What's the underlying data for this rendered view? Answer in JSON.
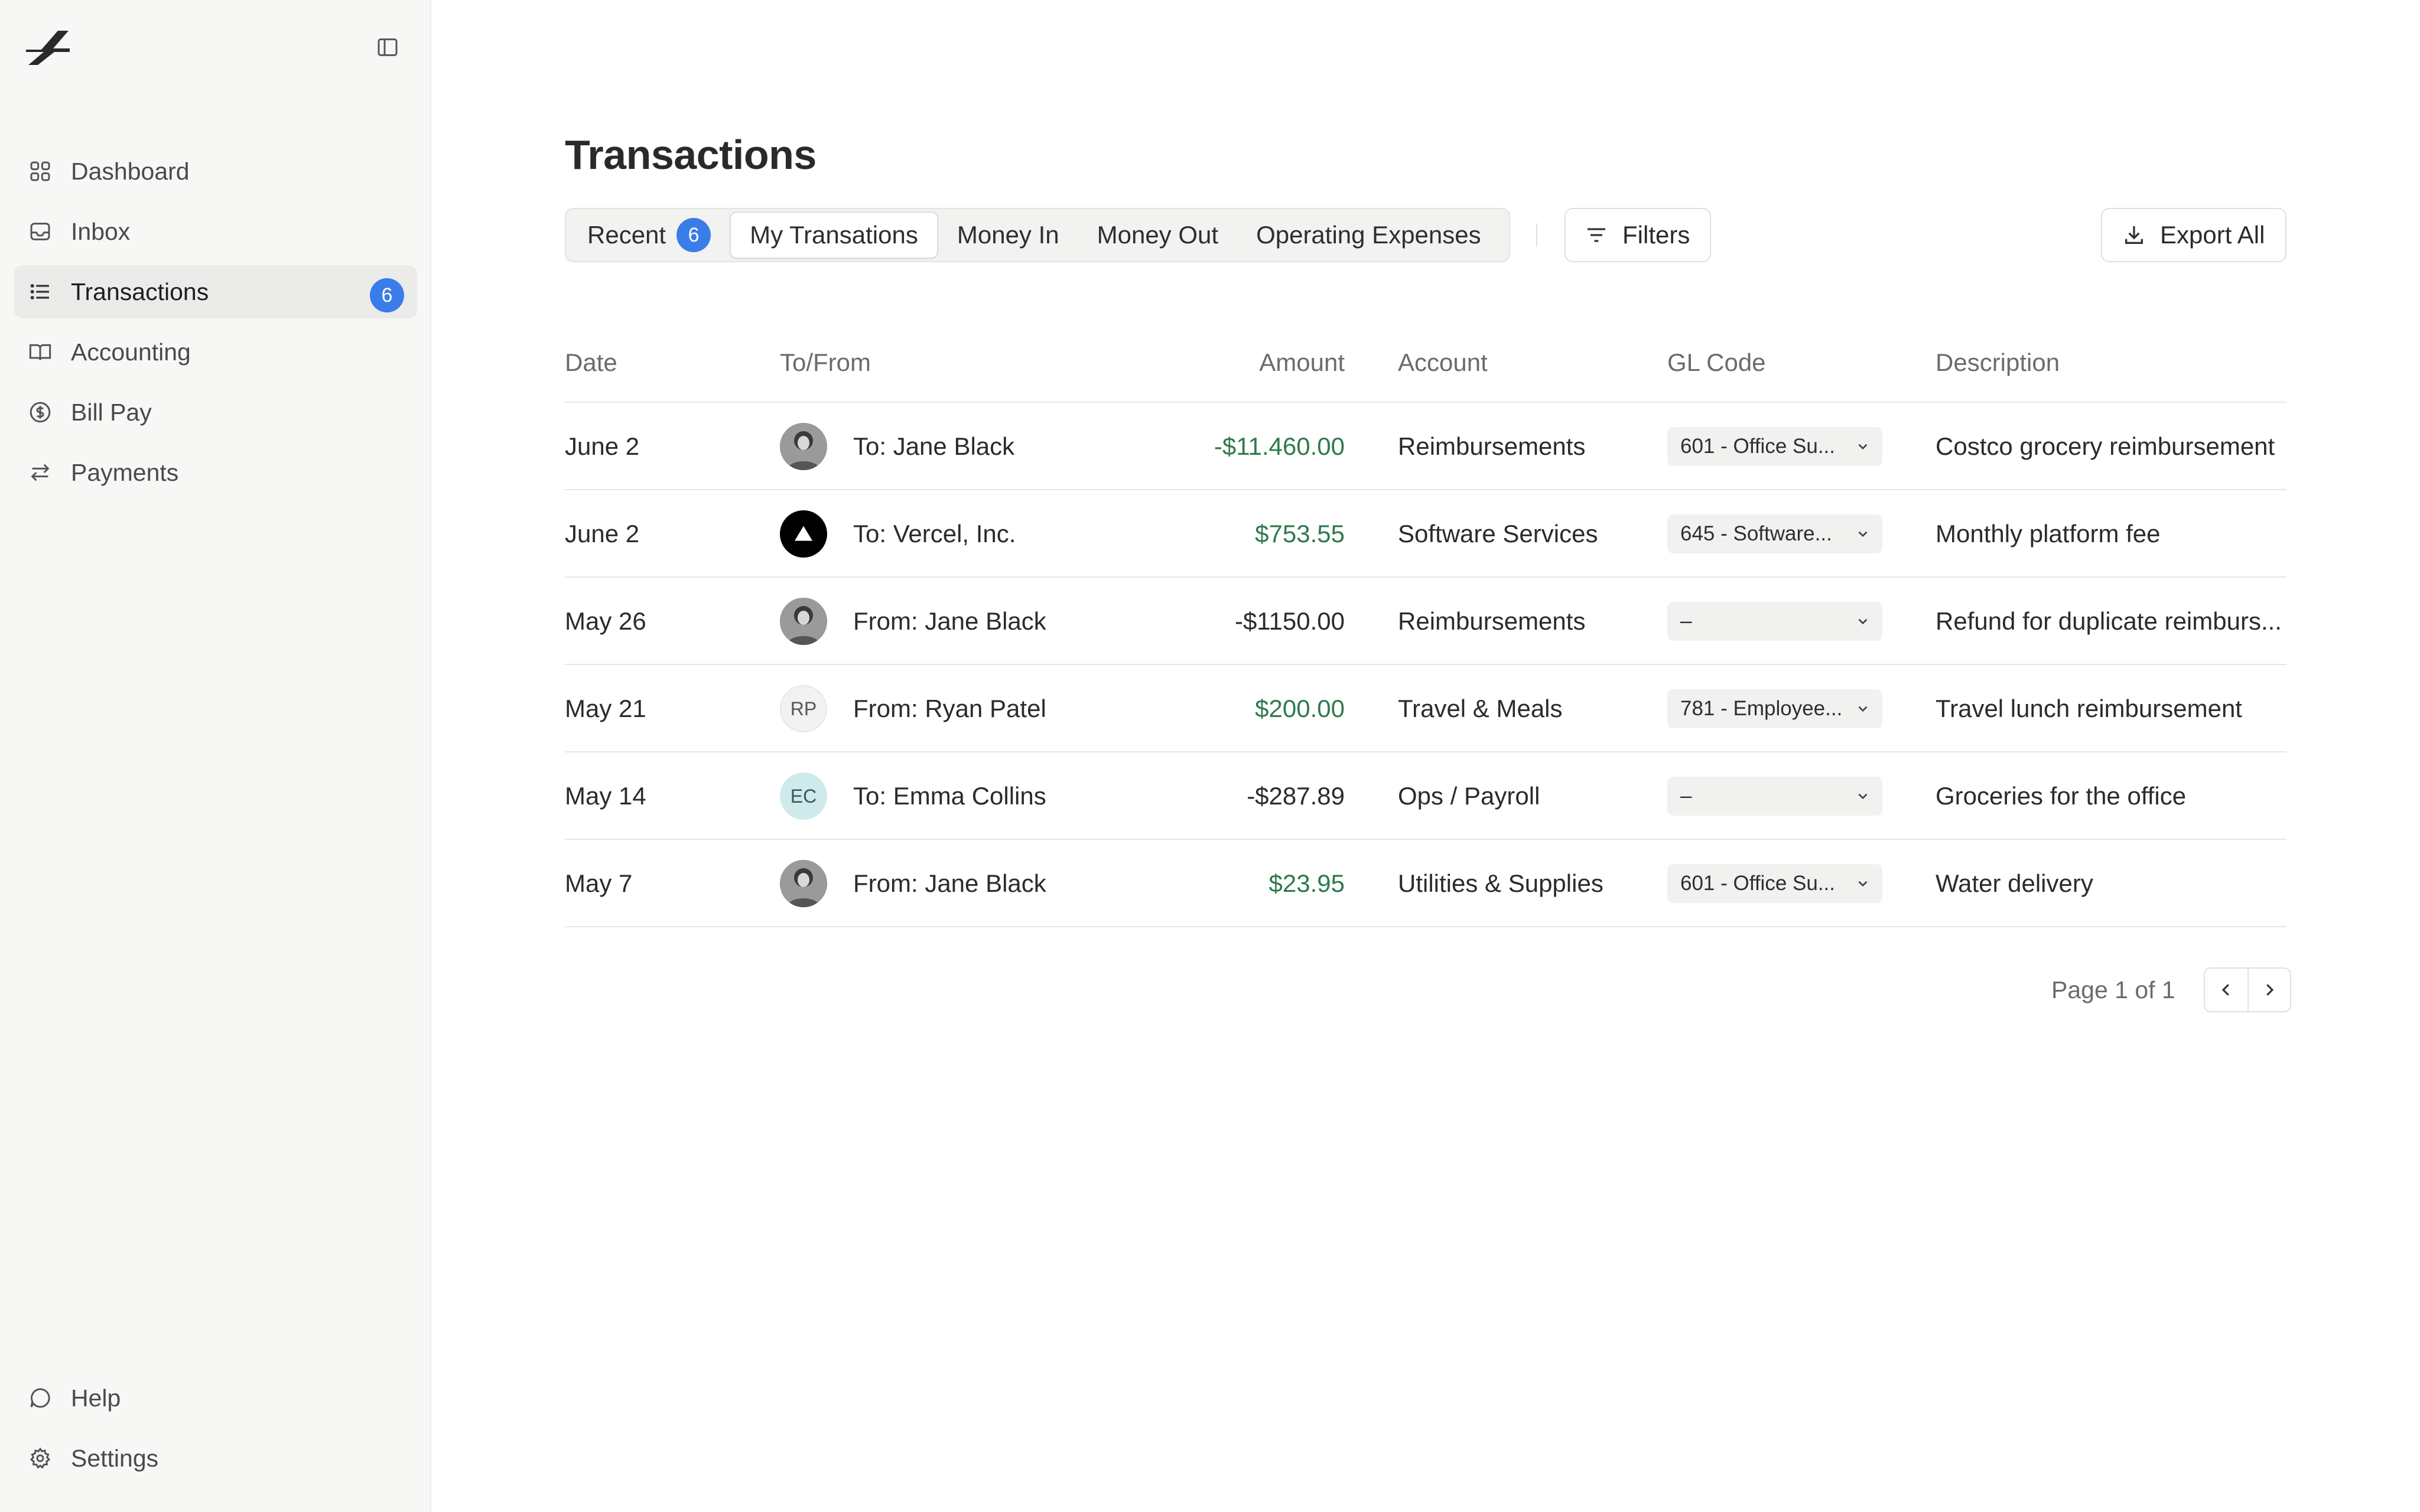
{
  "sidebar": {
    "items": [
      {
        "label": "Dashboard",
        "icon": "grid-icon"
      },
      {
        "label": "Inbox",
        "icon": "inbox-icon"
      },
      {
        "label": "Transactions",
        "icon": "list-icon",
        "badge": "6",
        "active": true
      },
      {
        "label": "Accounting",
        "icon": "book-icon"
      },
      {
        "label": "Bill Pay",
        "icon": "dollar-circle-icon"
      },
      {
        "label": "Payments",
        "icon": "arrows-swap-icon"
      }
    ],
    "bottom": [
      {
        "label": "Help",
        "icon": "chat-bubble-icon"
      },
      {
        "label": "Settings",
        "icon": "gear-icon"
      }
    ]
  },
  "main": {
    "title": "Transactions",
    "tabs": [
      {
        "label": "Recent",
        "badge": "6"
      },
      {
        "label": "My Transations",
        "selected": true
      },
      {
        "label": "Money In"
      },
      {
        "label": "Money Out"
      },
      {
        "label": "Operating Expenses"
      }
    ],
    "filters_label": "Filters",
    "export_label": "Export All"
  },
  "table": {
    "headers": {
      "date": "Date",
      "to_from": "To/From",
      "amount": "Amount",
      "account": "Account",
      "gl_code": "GL Code",
      "description": "Description"
    },
    "rows": [
      {
        "date": "June 2",
        "party": "To: Jane Black",
        "avatar": "photo",
        "amount": "-$11.460.00",
        "amount_color": "#2f7a4c",
        "account": "Reimbursements",
        "gl_code": "601 - Office Su...",
        "description": "Costco grocery reimbursement"
      },
      {
        "date": "June 2",
        "party": "To: Vercel, Inc.",
        "avatar": "vercel-logo",
        "amount": "$753.55",
        "amount_color": "#2f7a4c",
        "account": "Software Services",
        "gl_code": "645 - Software...",
        "description": "Monthly platform fee"
      },
      {
        "date": "May 26",
        "party": "From: Jane Black",
        "avatar": "photo",
        "amount": "-$1150.00",
        "amount_color": "#2b2b2b",
        "account": "Reimbursements",
        "gl_code": "–",
        "description": "Refund for duplicate reimburs..."
      },
      {
        "date": "May 21",
        "party": "From: Ryan Patel",
        "avatar": "RP",
        "amount": "$200.00",
        "amount_color": "#2f7a4c",
        "account": "Travel & Meals",
        "gl_code": "781 - Employee...",
        "description": "Travel lunch reimbursement"
      },
      {
        "date": "May 14",
        "party": "To: Emma Collins",
        "avatar": "EC",
        "amount": "-$287.89",
        "amount_color": "#2b2b2b",
        "account": "Ops / Payroll",
        "gl_code": "–",
        "description": "Groceries for the office"
      },
      {
        "date": "May 7",
        "party": "From: Jane Black",
        "avatar": "photo",
        "amount": "$23.95",
        "amount_color": "#2f7a4c",
        "account": "Utilities & Supplies",
        "gl_code": "601 - Office Su...",
        "description": "Water delivery"
      }
    ]
  },
  "pagination": {
    "text": "Page 1 of 1"
  },
  "colors": {
    "accent": "#3b7de8",
    "positive": "#2f7a4c"
  }
}
